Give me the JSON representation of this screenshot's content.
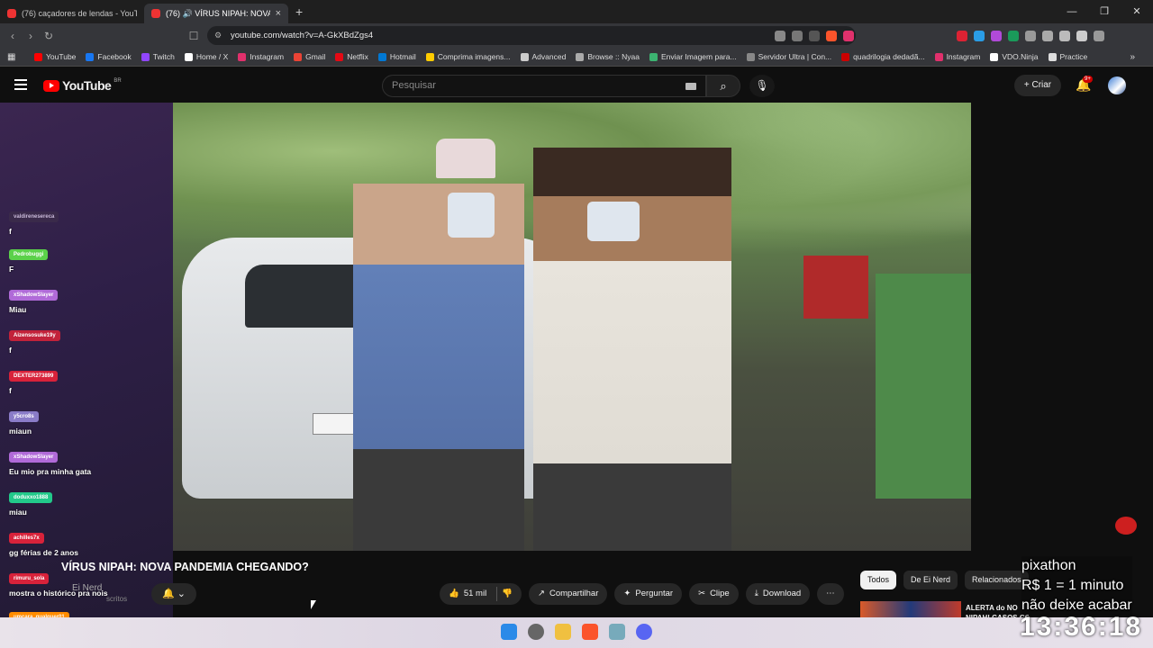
{
  "browser": {
    "tabs": [
      {
        "label": "(76) caçadores de lendas - YouTube"
      },
      {
        "label": "(76) 🔊 VÍRUS NIPAH: NOVA"
      }
    ],
    "new_tab": "+",
    "url": "youtube.com/watch?v=A-GkXBdZgs4",
    "bookmarks": [
      {
        "label": "YouTube",
        "color": "#ff0000"
      },
      {
        "label": "Facebook",
        "color": "#1877f2"
      },
      {
        "label": "Twitch",
        "color": "#9146ff"
      },
      {
        "label": "Home / X",
        "color": "#ffffff"
      },
      {
        "label": "Instagram",
        "color": "#e1306c"
      },
      {
        "label": "Gmail",
        "color": "#ea4335"
      },
      {
        "label": "Netflix",
        "color": "#e50914"
      },
      {
        "label": "Hotmail",
        "color": "#0078d4"
      },
      {
        "label": "Comprima imagens...",
        "color": "#ffcc00"
      },
      {
        "label": "Advanced",
        "color": "#cccccc"
      },
      {
        "label": "Browse :: Nyaa",
        "color": "#aaaaaa"
      },
      {
        "label": "Enviar Imagem para...",
        "color": "#3cb371"
      },
      {
        "label": "Servidor Ultra | Con...",
        "color": "#888888"
      },
      {
        "label": "quadrilogia dedadã...",
        "color": "#cc0000"
      },
      {
        "label": "Instagram",
        "color": "#e1306c"
      },
      {
        "label": "VDO.Ninja",
        "color": "#ffffff"
      },
      {
        "label": "Practice",
        "color": "#dddddd"
      }
    ]
  },
  "youtube": {
    "logo_text": "YouTube",
    "region": "BR",
    "search_placeholder": "Pesquisar",
    "create_label": "Criar",
    "notif_count": "9+",
    "video": {
      "title": "VÍRUS NIPAH: NOVA PANDEMIA CHEGANDO?",
      "channel": "Ei Nerd",
      "subs_suffix": "scritos",
      "likes": "51 mil",
      "share": "Compartilhar",
      "ask": "Perguntar",
      "clip": "Clipe",
      "download": "Download"
    },
    "chips": [
      "Todos",
      "De Ei Nerd",
      "Relacionados"
    ],
    "related_title": "ALERTA do NO",
    "related_sub": "NIPAH! CASOS CONFIRMADO"
  },
  "chat": [
    {
      "user": "valdirenesereca",
      "msg": "f",
      "color": "#3a2a4a"
    },
    {
      "user": "Pedrobuggi",
      "msg": "F",
      "color": "#5bd14a"
    },
    {
      "user": "xShadowSlayer",
      "msg": "Miau",
      "color": "#b06ad8"
    },
    {
      "user": "Aizensosuke19y",
      "msg": "f",
      "color": "#c2223a"
    },
    {
      "user": "DEXTER273899",
      "msg": "f",
      "color": "#d8223a"
    },
    {
      "user": "y5cro8s",
      "msg": "miaun",
      "color": "#8a7cc8"
    },
    {
      "user": "xShadowSlayer",
      "msg": "Eu mio pra minha gata",
      "color": "#b06ad8"
    },
    {
      "user": "doduxxo1888",
      "msg": "miau",
      "color": "#22c98a"
    },
    {
      "user": "achilles7x",
      "msg": "gg férias de 2 anos",
      "color": "#d8223a"
    },
    {
      "user": "rimuru_sola",
      "msg": "mostra o histórico pra nois",
      "color": "#d8223a"
    },
    {
      "user": "umcara_qualquer01",
      "msg": "",
      "color": "#ff8c00"
    }
  ],
  "overlay": {
    "line1": "pixathon",
    "line2": "R$ 1 = 1 minuto",
    "line3": "não deixe acabar",
    "clock": "13:36:18"
  }
}
